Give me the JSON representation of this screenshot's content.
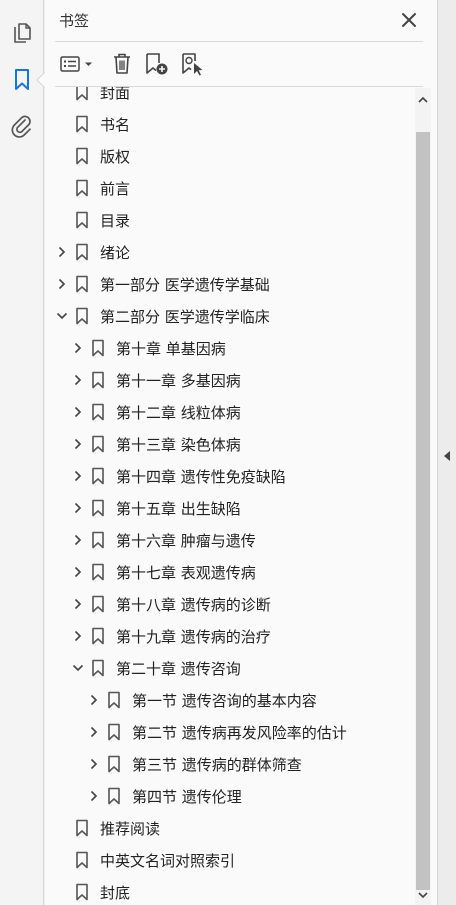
{
  "rail": {
    "items": [
      {
        "name": "pages-icon",
        "active": false
      },
      {
        "name": "bookmark-icon",
        "active": true
      },
      {
        "name": "attachment-icon",
        "active": false
      }
    ]
  },
  "panel": {
    "title": "书签",
    "close_icon": "close-icon"
  },
  "toolbar": {
    "icons": [
      "options-menu-icon",
      "delete-icon",
      "new-bookmark-icon",
      "bookmark-search-icon"
    ]
  },
  "colors": {
    "accent": "#1473e6",
    "icon": "#555555",
    "text": "#222222"
  },
  "tree": {
    "items": [
      {
        "label": "封面",
        "level": 0,
        "expander": "none"
      },
      {
        "label": "书名",
        "level": 0,
        "expander": "none"
      },
      {
        "label": "版权",
        "level": 0,
        "expander": "none"
      },
      {
        "label": "前言",
        "level": 0,
        "expander": "none"
      },
      {
        "label": "目录",
        "level": 0,
        "expander": "none"
      },
      {
        "label": "绪论",
        "level": 0,
        "expander": "collapsed"
      },
      {
        "label": "第一部分  医学遗传学基础",
        "level": 0,
        "expander": "collapsed"
      },
      {
        "label": "第二部分  医学遗传学临床",
        "level": 0,
        "expander": "expanded"
      },
      {
        "label": "第十章  单基因病",
        "level": 1,
        "expander": "collapsed"
      },
      {
        "label": "第十一章  多基因病",
        "level": 1,
        "expander": "collapsed"
      },
      {
        "label": "第十二章  线粒体病",
        "level": 1,
        "expander": "collapsed"
      },
      {
        "label": "第十三章  染色体病",
        "level": 1,
        "expander": "collapsed"
      },
      {
        "label": "第十四章  遗传性免疫缺陷",
        "level": 1,
        "expander": "collapsed"
      },
      {
        "label": "第十五章  出生缺陷",
        "level": 1,
        "expander": "collapsed"
      },
      {
        "label": "第十六章  肿瘤与遗传",
        "level": 1,
        "expander": "collapsed"
      },
      {
        "label": "第十七章  表观遗传病",
        "level": 1,
        "expander": "collapsed"
      },
      {
        "label": "第十八章  遗传病的诊断",
        "level": 1,
        "expander": "collapsed"
      },
      {
        "label": "第十九章  遗传病的治疗",
        "level": 1,
        "expander": "collapsed"
      },
      {
        "label": "第二十章  遗传咨询",
        "level": 1,
        "expander": "expanded"
      },
      {
        "label": "第一节  遗传咨询的基本内容",
        "level": 2,
        "expander": "collapsed"
      },
      {
        "label": "第二节  遗传病再发风险率的估计",
        "level": 2,
        "expander": "collapsed"
      },
      {
        "label": "第三节  遗传病的群体筛查",
        "level": 2,
        "expander": "collapsed"
      },
      {
        "label": "第四节  遗传伦理",
        "level": 2,
        "expander": "collapsed"
      },
      {
        "label": "推荐阅读",
        "level": 0,
        "expander": "none"
      },
      {
        "label": "中英文名词对照索引",
        "level": 0,
        "expander": "none"
      },
      {
        "label": "封底",
        "level": 0,
        "expander": "none"
      }
    ]
  },
  "scrollbar": {
    "up_icon": "chevron-up-icon",
    "down_icon": "chevron-down-icon",
    "position": 0.97
  },
  "side_collapse": {
    "icon": "collapse-left-icon"
  }
}
